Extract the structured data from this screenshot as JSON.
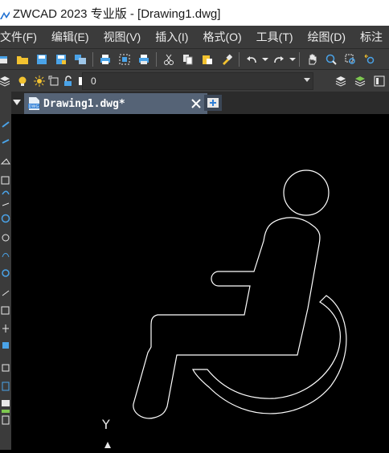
{
  "window": {
    "title": "ZWCAD 2023 专业版 - [Drawing1.dwg]"
  },
  "menu": [
    "文件(F)",
    "编辑(E)",
    "视图(V)",
    "插入(I)",
    "格式(O)",
    "工具(T)",
    "绘图(D)",
    "标注"
  ],
  "toolbar_standard": [
    "new-icon",
    "open-icon",
    "save-icon",
    "save-as-icon",
    "publish-icon",
    "sep",
    "plot-icon",
    "plot-preview-icon",
    "plot-setup-icon",
    "sep",
    "cut-icon",
    "copy-icon",
    "paste-icon",
    "match-properties-icon",
    "sep",
    "undo-icon",
    "undo-dropdown-icon",
    "redo-icon",
    "redo-dropdown-icon",
    "sep",
    "pan-icon",
    "zoom-realtime-icon",
    "zoom-window-icon",
    "zoom-previous-icon"
  ],
  "layer": {
    "current": "0",
    "color": "#ffffff"
  },
  "tabs": {
    "active_label": "Drawing1.dwg*"
  },
  "ucs": {
    "y_label": "Y"
  },
  "colors": {
    "menubar": "#3b3b3b",
    "tab_active": "#556376",
    "canvas": "#000000",
    "lines": "#ffffff",
    "icon_blue": "#4aa3e8",
    "icon_yellow": "#f2c230"
  }
}
